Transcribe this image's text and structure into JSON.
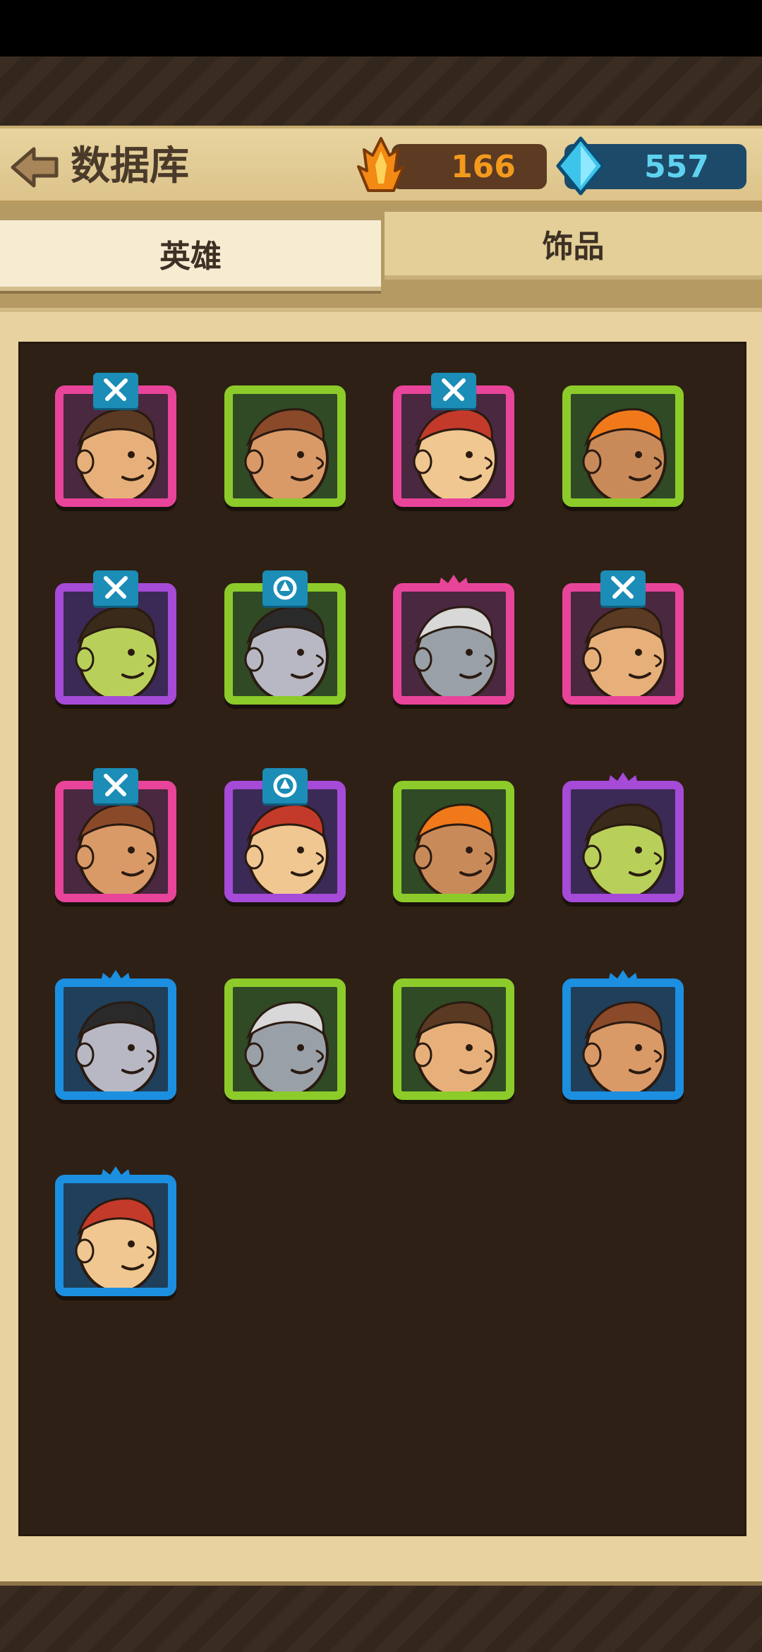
{
  "header": {
    "title": "数据库",
    "gold_amount": "166",
    "gem_amount": "557"
  },
  "tabs": [
    {
      "label": "英雄",
      "active": true
    },
    {
      "label": "饰品",
      "active": false
    }
  ],
  "colors": {
    "pink": "#e8449a",
    "green": "#8ccb2a",
    "purple": "#a64ad8",
    "blue": "#1c8fe0",
    "gold_text": "#f39a1d",
    "gem_text": "#5fd2f0"
  },
  "heroes": [
    {
      "frame": "pink",
      "badge": "crossed-swords-icon"
    },
    {
      "frame": "green",
      "badge": null
    },
    {
      "frame": "pink",
      "badge": "crossed-swords-icon"
    },
    {
      "frame": "green",
      "badge": null
    },
    {
      "frame": "purple",
      "badge": "crossed-swords-icon"
    },
    {
      "frame": "green",
      "badge": "shield-icon"
    },
    {
      "frame": "pink",
      "badge": "crown-icon"
    },
    {
      "frame": "pink",
      "badge": "crossed-swords-icon"
    },
    {
      "frame": "pink",
      "badge": "crossed-swords-icon"
    },
    {
      "frame": "purple",
      "badge": "shield-icon"
    },
    {
      "frame": "green",
      "badge": null
    },
    {
      "frame": "purple",
      "badge": "crown-icon"
    },
    {
      "frame": "blue",
      "badge": "crown-icon"
    },
    {
      "frame": "green",
      "badge": null
    },
    {
      "frame": "green",
      "badge": null
    },
    {
      "frame": "blue",
      "badge": "crown-icon"
    },
    {
      "frame": "blue",
      "badge": "crown-icon"
    }
  ]
}
